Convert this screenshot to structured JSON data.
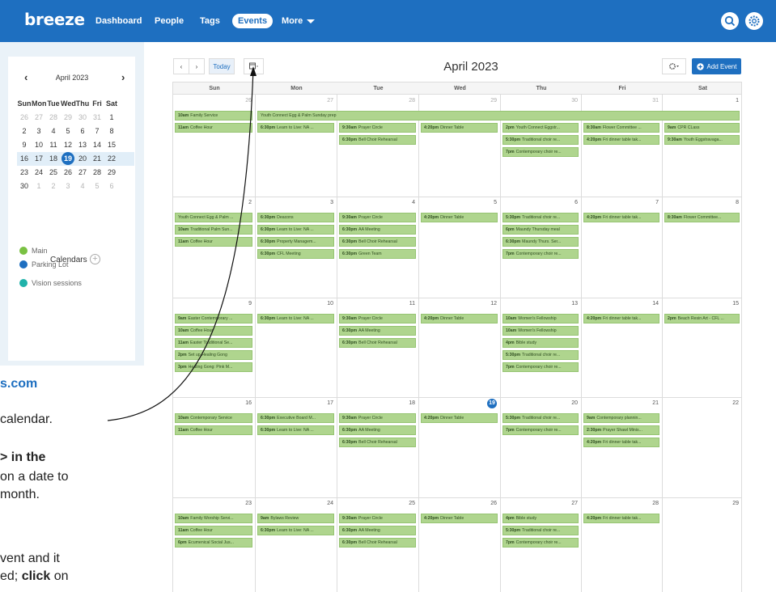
{
  "topbar": {
    "logo": "breeze",
    "nav": [
      "Dashboard",
      "People",
      "Tags",
      "Events",
      "More"
    ],
    "search_icon": "search-icon",
    "settings_icon": "gear-icon",
    "color": "#1e6fc0"
  },
  "mini_calendar": {
    "month_label": "April 2023",
    "prev": "‹",
    "next": "›",
    "headers": [
      "Sun",
      "Mon",
      "Tue",
      "Wed",
      "Thu",
      "Fri",
      "Sat"
    ],
    "weeks": [
      [
        "26",
        "27",
        "28",
        "29",
        "30",
        "31",
        "1"
      ],
      [
        "2",
        "3",
        "4",
        "5",
        "6",
        "7",
        "8"
      ],
      [
        "9",
        "10",
        "11",
        "12",
        "13",
        "14",
        "15"
      ],
      [
        "16",
        "17",
        "18",
        "19",
        "20",
        "21",
        "22"
      ],
      [
        "23",
        "24",
        "25",
        "26",
        "27",
        "28",
        "29"
      ],
      [
        "30",
        "1",
        "2",
        "3",
        "4",
        "5",
        "6"
      ]
    ],
    "today": "19"
  },
  "calendars": {
    "label": "Calendars",
    "add": "+",
    "items": [
      {
        "name": "Main",
        "color": "#7ac143"
      },
      {
        "name": "Parking Lot",
        "color": "#1e6fc0"
      },
      {
        "name": "Vision sessions",
        "color": "#20b2aa"
      }
    ]
  },
  "instructions": {
    "url": "s.com",
    "line1": "calendar.",
    "line2": ">  in the",
    "line3": "on a date to",
    "line4": "month.",
    "line5": "vent and it",
    "line6_prefix": "ed; ",
    "line6_bold": "click",
    "line6_suffix": " on"
  },
  "toolbar": {
    "prev": "‹",
    "next": "›",
    "today": "Today",
    "view_icon": "calendar-view-icon",
    "title": "April 2023",
    "settings_icon": "gear-icon",
    "add_event": "Add Event"
  },
  "grid": {
    "weekdays": [
      "Sun",
      "Mon",
      "Tue",
      "Wed",
      "Thu",
      "Fri",
      "Sat"
    ],
    "weeks": [
      [
        {
          "d": "26",
          "o": true
        },
        {
          "d": "27",
          "o": true
        },
        {
          "d": "28",
          "o": true
        },
        {
          "d": "29",
          "o": true
        },
        {
          "d": "30",
          "o": true
        },
        {
          "d": "31",
          "o": true
        },
        {
          "d": "1"
        }
      ],
      [
        {
          "d": "2"
        },
        {
          "d": "3"
        },
        {
          "d": "4"
        },
        {
          "d": "5"
        },
        {
          "d": "6"
        },
        {
          "d": "7"
        },
        {
          "d": "8"
        }
      ],
      [
        {
          "d": "9"
        },
        {
          "d": "10"
        },
        {
          "d": "11"
        },
        {
          "d": "12"
        },
        {
          "d": "13"
        },
        {
          "d": "14"
        },
        {
          "d": "15"
        }
      ],
      [
        {
          "d": "16"
        },
        {
          "d": "17"
        },
        {
          "d": "18"
        },
        {
          "d": "19",
          "today": true
        },
        {
          "d": "20"
        },
        {
          "d": "21"
        },
        {
          "d": "22"
        }
      ],
      [
        {
          "d": "23"
        },
        {
          "d": "24"
        },
        {
          "d": "25"
        },
        {
          "d": "26"
        },
        {
          "d": "27"
        },
        {
          "d": "28"
        },
        {
          "d": "29"
        }
      ]
    ]
  },
  "events": [
    {
      "week": 0,
      "col": 0,
      "slot": 0,
      "span": 1,
      "time": "10am",
      "title": "Family Service"
    },
    {
      "week": 0,
      "col": 1,
      "slot": 0,
      "span": 6,
      "time": "",
      "title": "Youth Connect Egg & Palm Sunday prep"
    },
    {
      "week": 0,
      "col": 0,
      "slot": 1,
      "span": 1,
      "time": "11am",
      "title": "Coffee Hour"
    },
    {
      "week": 0,
      "col": 1,
      "slot": 1,
      "span": 1,
      "time": "6:30pm",
      "title": "Learn to Live: NA ..."
    },
    {
      "week": 0,
      "col": 2,
      "slot": 1,
      "span": 1,
      "time": "9:30am",
      "title": "Prayer Circle"
    },
    {
      "week": 0,
      "col": 3,
      "slot": 1,
      "span": 1,
      "time": "4:20pm",
      "title": "Dinner Table"
    },
    {
      "week": 0,
      "col": 4,
      "slot": 1,
      "span": 1,
      "time": "2pm",
      "title": "Youth Connect Eggstr..."
    },
    {
      "week": 0,
      "col": 5,
      "slot": 1,
      "span": 1,
      "time": "8:30am",
      "title": "Flower Committee ..."
    },
    {
      "week": 0,
      "col": 6,
      "slot": 1,
      "span": 1,
      "time": "9am",
      "title": "CPR CLass"
    },
    {
      "week": 0,
      "col": 2,
      "slot": 2,
      "span": 1,
      "time": "6:30pm",
      "title": "Bell Choir Rehearsal"
    },
    {
      "week": 0,
      "col": 4,
      "slot": 2,
      "span": 1,
      "time": "5:30pm",
      "title": "Traditional choir re..."
    },
    {
      "week": 0,
      "col": 5,
      "slot": 2,
      "span": 1,
      "time": "4:20pm",
      "title": "Fri dinner table tak..."
    },
    {
      "week": 0,
      "col": 6,
      "slot": 2,
      "span": 1,
      "time": "9:30am",
      "title": "Youth Eggstravaga..."
    },
    {
      "week": 0,
      "col": 4,
      "slot": 3,
      "span": 1,
      "time": "7pm",
      "title": "Contemporary choir re..."
    },
    {
      "week": 1,
      "col": 0,
      "slot": 0,
      "span": 1,
      "time": "",
      "title": "Youth Connect Egg & Palm ..."
    },
    {
      "week": 1,
      "col": 1,
      "slot": 0,
      "span": 1,
      "time": "6:30pm",
      "title": "Deacons"
    },
    {
      "week": 1,
      "col": 2,
      "slot": 0,
      "span": 1,
      "time": "9:30am",
      "title": "Prayer Circle"
    },
    {
      "week": 1,
      "col": 3,
      "slot": 0,
      "span": 1,
      "time": "4:20pm",
      "title": "Dinner Table"
    },
    {
      "week": 1,
      "col": 4,
      "slot": 0,
      "span": 1,
      "time": "5:30pm",
      "title": "Traditional choir re..."
    },
    {
      "week": 1,
      "col": 5,
      "slot": 0,
      "span": 1,
      "time": "4:20pm",
      "title": "Fri dinner table tak..."
    },
    {
      "week": 1,
      "col": 6,
      "slot": 0,
      "span": 1,
      "time": "8:30am",
      "title": "Flower Committee..."
    },
    {
      "week": 1,
      "col": 0,
      "slot": 1,
      "span": 1,
      "time": "10am",
      "title": "Traditional Palm Sun..."
    },
    {
      "week": 1,
      "col": 1,
      "slot": 1,
      "span": 1,
      "time": "6:30pm",
      "title": "Learn to Live: NA ..."
    },
    {
      "week": 1,
      "col": 2,
      "slot": 1,
      "span": 1,
      "time": "6:30pm",
      "title": "AA Meeting"
    },
    {
      "week": 1,
      "col": 4,
      "slot": 1,
      "span": 1,
      "time": "6pm",
      "title": "Maundy Thursday meal"
    },
    {
      "week": 1,
      "col": 0,
      "slot": 2,
      "span": 1,
      "time": "11am",
      "title": "Coffee Hour"
    },
    {
      "week": 1,
      "col": 1,
      "slot": 2,
      "span": 1,
      "time": "6:30pm",
      "title": "Property Managem..."
    },
    {
      "week": 1,
      "col": 2,
      "slot": 2,
      "span": 1,
      "time": "6:30pm",
      "title": "Bell Choir Rehearsal"
    },
    {
      "week": 1,
      "col": 4,
      "slot": 2,
      "span": 1,
      "time": "6:30pm",
      "title": "Maundy Thurs. Ser..."
    },
    {
      "week": 1,
      "col": 1,
      "slot": 3,
      "span": 1,
      "time": "6:30pm",
      "title": "CFL Meeting"
    },
    {
      "week": 1,
      "col": 2,
      "slot": 3,
      "span": 1,
      "time": "6:30pm",
      "title": "Green Team"
    },
    {
      "week": 1,
      "col": 4,
      "slot": 3,
      "span": 1,
      "time": "7pm",
      "title": "Contemporary choir re..."
    },
    {
      "week": 2,
      "col": 0,
      "slot": 0,
      "span": 1,
      "time": "9am",
      "title": "Easter Contemporary ..."
    },
    {
      "week": 2,
      "col": 1,
      "slot": 0,
      "span": 1,
      "time": "6:30pm",
      "title": "Learn to Live: NA ..."
    },
    {
      "week": 2,
      "col": 2,
      "slot": 0,
      "span": 1,
      "time": "9:30am",
      "title": "Prayer Circle"
    },
    {
      "week": 2,
      "col": 3,
      "slot": 0,
      "span": 1,
      "time": "4:20pm",
      "title": "Dinner Table"
    },
    {
      "week": 2,
      "col": 4,
      "slot": 0,
      "span": 1,
      "time": "10am",
      "title": "Women's Fellowship"
    },
    {
      "week": 2,
      "col": 5,
      "slot": 0,
      "span": 1,
      "time": "4:20pm",
      "title": "Fri dinner table tak..."
    },
    {
      "week": 2,
      "col": 6,
      "slot": 0,
      "span": 1,
      "time": "2pm",
      "title": "Beach Resin Art - CFL ..."
    },
    {
      "week": 2,
      "col": 0,
      "slot": 1,
      "span": 1,
      "time": "10am",
      "title": "Coffee Hour"
    },
    {
      "week": 2,
      "col": 2,
      "slot": 1,
      "span": 1,
      "time": "6:30pm",
      "title": "AA Meeting"
    },
    {
      "week": 2,
      "col": 4,
      "slot": 1,
      "span": 1,
      "time": "10am",
      "title": "Women's Fellowship"
    },
    {
      "week": 2,
      "col": 0,
      "slot": 2,
      "span": 1,
      "time": "11am",
      "title": "Easter Traditional Se..."
    },
    {
      "week": 2,
      "col": 2,
      "slot": 2,
      "span": 1,
      "time": "6:30pm",
      "title": "Bell Choir Rehearsal"
    },
    {
      "week": 2,
      "col": 4,
      "slot": 2,
      "span": 1,
      "time": "4pm",
      "title": "Bible study"
    },
    {
      "week": 2,
      "col": 0,
      "slot": 3,
      "span": 1,
      "time": "2pm",
      "title": "Set up Healing Gong"
    },
    {
      "week": 2,
      "col": 4,
      "slot": 3,
      "span": 1,
      "time": "5:30pm",
      "title": "Traditional choir re..."
    },
    {
      "week": 2,
      "col": 0,
      "slot": 4,
      "span": 1,
      "time": "3pm",
      "title": "Healing Gong: Pink M..."
    },
    {
      "week": 2,
      "col": 4,
      "slot": 4,
      "span": 1,
      "time": "7pm",
      "title": "Contemporary choir re..."
    },
    {
      "week": 3,
      "col": 0,
      "slot": 0,
      "span": 1,
      "time": "10am",
      "title": "Contemporary Service"
    },
    {
      "week": 3,
      "col": 1,
      "slot": 0,
      "span": 1,
      "time": "6:30pm",
      "title": "Executive Board M..."
    },
    {
      "week": 3,
      "col": 2,
      "slot": 0,
      "span": 1,
      "time": "9:30am",
      "title": "Prayer Circle"
    },
    {
      "week": 3,
      "col": 3,
      "slot": 0,
      "span": 1,
      "time": "4:20pm",
      "title": "Dinner Table"
    },
    {
      "week": 3,
      "col": 4,
      "slot": 0,
      "span": 1,
      "time": "5:30pm",
      "title": "Traditional choir re..."
    },
    {
      "week": 3,
      "col": 5,
      "slot": 0,
      "span": 1,
      "time": "9am",
      "title": "Contemporary plannin..."
    },
    {
      "week": 3,
      "col": 0,
      "slot": 1,
      "span": 1,
      "time": "11am",
      "title": "Coffee Hour"
    },
    {
      "week": 3,
      "col": 1,
      "slot": 1,
      "span": 1,
      "time": "6:30pm",
      "title": "Learn to Live: NA ..."
    },
    {
      "week": 3,
      "col": 2,
      "slot": 1,
      "span": 1,
      "time": "6:30pm",
      "title": "AA Meeting"
    },
    {
      "week": 3,
      "col": 4,
      "slot": 1,
      "span": 1,
      "time": "7pm",
      "title": "Contemporary choir re..."
    },
    {
      "week": 3,
      "col": 5,
      "slot": 1,
      "span": 1,
      "time": "2:30pm",
      "title": "Prayer Shawl Minis..."
    },
    {
      "week": 3,
      "col": 2,
      "slot": 2,
      "span": 1,
      "time": "6:30pm",
      "title": "Bell Choir Rehearsal"
    },
    {
      "week": 3,
      "col": 5,
      "slot": 2,
      "span": 1,
      "time": "4:20pm",
      "title": "Fri dinner table tak..."
    },
    {
      "week": 4,
      "col": 0,
      "slot": 0,
      "span": 1,
      "time": "10am",
      "title": "Family Worship Servi..."
    },
    {
      "week": 4,
      "col": 1,
      "slot": 0,
      "span": 1,
      "time": "9am",
      "title": "Bylaws Review"
    },
    {
      "week": 4,
      "col": 2,
      "slot": 0,
      "span": 1,
      "time": "9:30am",
      "title": "Prayer Circle"
    },
    {
      "week": 4,
      "col": 3,
      "slot": 0,
      "span": 1,
      "time": "4:20pm",
      "title": "Dinner Table"
    },
    {
      "week": 4,
      "col": 4,
      "slot": 0,
      "span": 1,
      "time": "4pm",
      "title": "Bible study"
    },
    {
      "week": 4,
      "col": 5,
      "slot": 0,
      "span": 1,
      "time": "4:20pm",
      "title": "Fri dinner table tak..."
    },
    {
      "week": 4,
      "col": 0,
      "slot": 1,
      "span": 1,
      "time": "11am",
      "title": "Coffee Hour"
    },
    {
      "week": 4,
      "col": 1,
      "slot": 1,
      "span": 1,
      "time": "6:30pm",
      "title": "Learn to Live: NA ..."
    },
    {
      "week": 4,
      "col": 2,
      "slot": 1,
      "span": 1,
      "time": "6:30pm",
      "title": "AA Meeting"
    },
    {
      "week": 4,
      "col": 4,
      "slot": 1,
      "span": 1,
      "time": "5:30pm",
      "title": "Traditional choir re..."
    },
    {
      "week": 4,
      "col": 0,
      "slot": 2,
      "span": 1,
      "time": "6pm",
      "title": "Ecumenical Social Jus..."
    },
    {
      "week": 4,
      "col": 2,
      "slot": 2,
      "span": 1,
      "time": "6:30pm",
      "title": "Bell Choir Rehearsal"
    },
    {
      "week": 4,
      "col": 4,
      "slot": 2,
      "span": 1,
      "time": "7pm",
      "title": "Contemporary choir re..."
    }
  ]
}
